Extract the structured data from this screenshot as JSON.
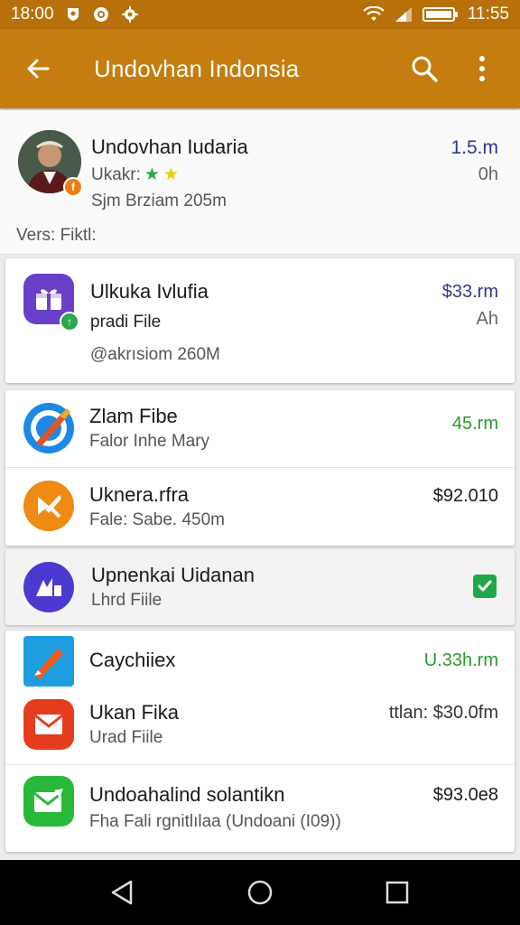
{
  "status_bar": {
    "time_left": "18:00",
    "time_right": "11:55"
  },
  "app_bar": {
    "title": "Undovhan Indonsia"
  },
  "profile": {
    "name": "Undovhan Iudaria",
    "rating_label": "Ukakr:",
    "stars": "★★",
    "size": "Sjm Brziam 205m",
    "price": "1.5.m",
    "time": "0h",
    "version": "Vers: Fiktl:"
  },
  "items": [
    {
      "title": "Ulkuka Ivlufia",
      "subtitle": "pradi File",
      "meta": "@akrısiom 260M",
      "price": "$33.rm",
      "time": "Ah"
    },
    {
      "title": "Zlam Fibe",
      "subtitle": "Falor Inhe Mary",
      "price": "45.rm"
    },
    {
      "title": "Uknera.rfra",
      "subtitle": "Fale: Sabe. 450m",
      "price": "$92.010"
    },
    {
      "title": "Upnenkai Uidanan",
      "subtitle": "Lhrd Fiile"
    },
    {
      "title": "Caychiiex",
      "price": "U.33h.rm"
    },
    {
      "title": "Ukan Fika",
      "subtitle": "Urad Fiile",
      "price": "ttlan: $30.0fm"
    },
    {
      "title": "Undoahalind solantikn",
      "subtitle": "Fha Fali rgnitlılaa (Undoani (I09))",
      "price": "$93.0e8"
    }
  ],
  "colors": {
    "appbar": "#c47d0e",
    "statusbar": "#b8700a",
    "price_blue": "#2a3a8a",
    "price_green": "#2a9a2a",
    "check_green": "#1fa84a"
  }
}
